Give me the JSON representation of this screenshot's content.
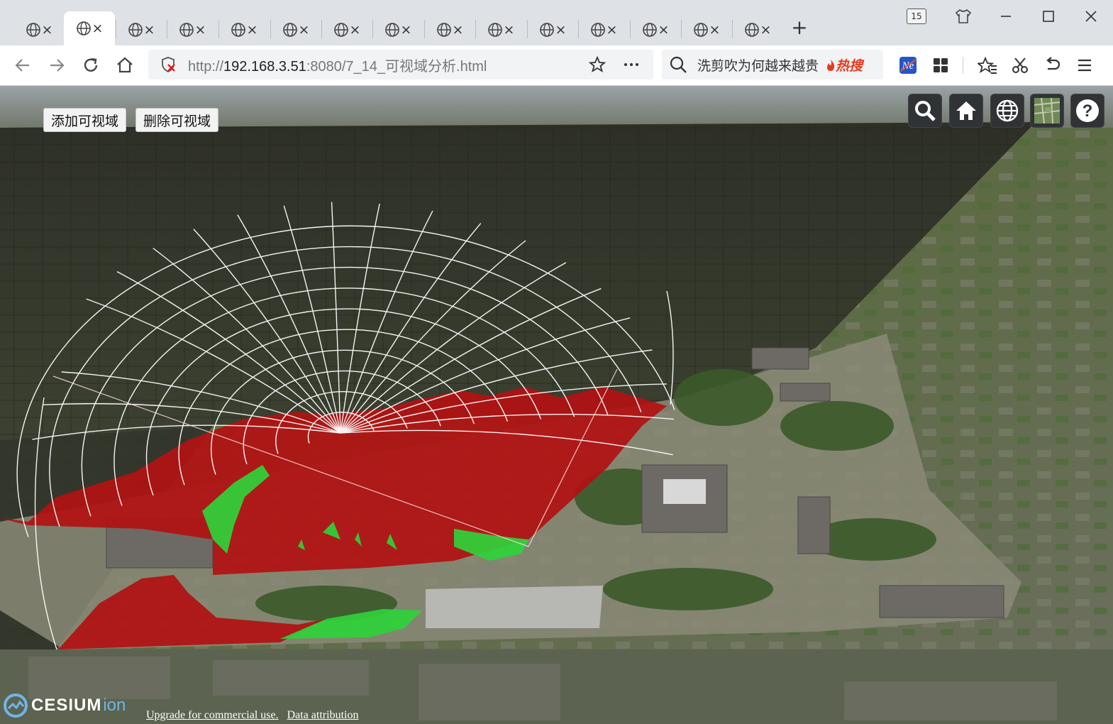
{
  "browser": {
    "tab_count_badge": "15",
    "tab_close_glyph": "×",
    "new_tab_glyph": "+",
    "url_prefix": "http://",
    "url_host": "192.168.3.51",
    "url_path": ":8080/7_14_可视域分析.html",
    "search_suggestion": "洗剪吹为何越来越贵",
    "search_badge": "热搜",
    "icons": {
      "tab": "globe-icon",
      "back": "arrow-left-icon",
      "forward": "arrow-right-icon",
      "reload": "reload-icon",
      "home": "home-icon",
      "security": "insecure-shield-icon",
      "bookmark": "star-icon",
      "more": "ellipsis-icon",
      "search": "search-icon",
      "extension": "ne-extension-icon",
      "apps": "apps-grid-icon",
      "favorites": "favorites-icon",
      "screenshot": "scissors-icon",
      "undo": "undo-icon",
      "menu": "hamburger-icon",
      "skin": "shirt-icon",
      "minimize": "minimize-icon",
      "maximize": "maximize-icon",
      "close": "close-icon"
    }
  },
  "page": {
    "add_button": "添加可视域",
    "delete_button": "删除可视域",
    "cesium_tools": [
      "search-icon",
      "home-icon",
      "globe-icon",
      "layer-picker-icon",
      "help-icon"
    ],
    "credits_upgrade": "Upgrade for commercial use.",
    "credits_attribution": "Data attribution",
    "logo_main": "CESIUM",
    "logo_ion": "ion",
    "colors": {
      "visible_area": "#2fd23a",
      "invisible_area": "#b01212",
      "sphere_grid": "#ffffff"
    }
  }
}
